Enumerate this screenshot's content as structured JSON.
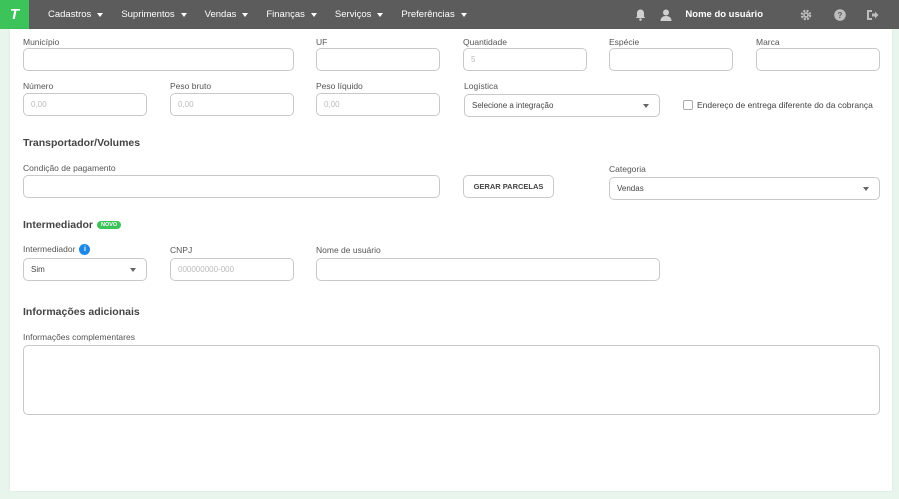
{
  "topbar": {
    "logo": "T",
    "menu": [
      {
        "label": "Cadastros"
      },
      {
        "label": "Suprimentos"
      },
      {
        "label": "Vendas"
      },
      {
        "label": "Finanças"
      },
      {
        "label": "Serviços"
      },
      {
        "label": "Preferências"
      }
    ],
    "username": "Nome do usuário",
    "icons": [
      "bell-icon",
      "user-icon",
      "gear-icon",
      "help-icon",
      "logout-icon"
    ]
  },
  "fields": {
    "municipio": {
      "label": "Município",
      "value": ""
    },
    "uf": {
      "label": "UF",
      "value": ""
    },
    "quantidade": {
      "label": "Quantidade",
      "placeholder": "5"
    },
    "especie": {
      "label": "Espécie",
      "value": ""
    },
    "marca": {
      "label": "Marca",
      "value": ""
    },
    "numero": {
      "label": "Número",
      "placeholder": "0,00"
    },
    "peso_bruto": {
      "label": "Peso bruto",
      "placeholder": "0,00"
    },
    "peso_liquido": {
      "label": "Peso líquido",
      "placeholder": "0,00"
    },
    "logistica": {
      "label": "Logística",
      "value": "Selecione a integração"
    },
    "endereco_checkbox": {
      "label": "Endereço de entrega diferente do da cobrança"
    }
  },
  "transportador": {
    "title": "Transportador/Volumes",
    "condicao_label": "Condição de pagamento",
    "gerar_button": "GERAR PARCELAS",
    "categoria_label": "Categoria",
    "categoria_value": "Vendas"
  },
  "intermediador": {
    "title": "Intermediador",
    "badge": "NOVO",
    "intermediador_label": "Intermediador",
    "intermediador_value": "Sim",
    "cnpj_label": "CNPJ",
    "cnpj_placeholder": "000000000-000",
    "usuario_label": "Nome de usuário"
  },
  "adicionais": {
    "title": "Informações adicionais",
    "complementares_label": "Informações complementares"
  },
  "colors": {
    "brand": "#3cc35a",
    "topbar": "#5c5c5c",
    "info": "#1e88e5"
  }
}
